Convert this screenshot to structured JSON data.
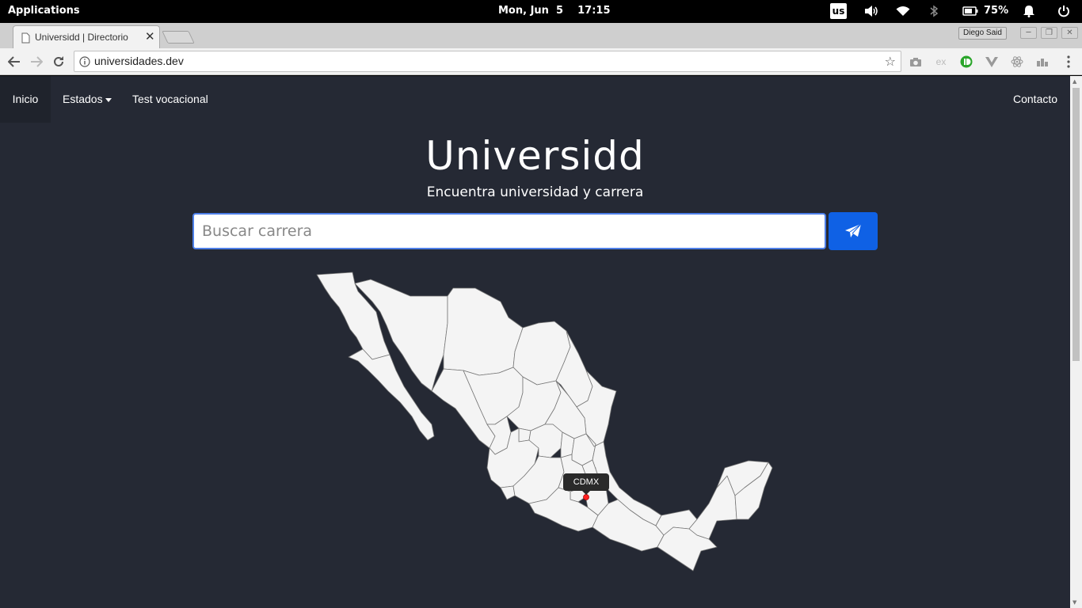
{
  "topbar": {
    "applications": "Applications",
    "date": "Mon, Jun  5",
    "time": "17:15",
    "keyboard_layout": "us",
    "battery_percent": "75%"
  },
  "browser": {
    "tab_title": "Universidd | Directorio",
    "profile_name": "Diego Said",
    "url": "universidades.dev"
  },
  "nav": {
    "items": [
      {
        "label": "Inicio",
        "active": true
      },
      {
        "label": "Estados",
        "dropdown": true
      },
      {
        "label": "Test vocacional"
      }
    ],
    "right_item": "Contacto"
  },
  "hero": {
    "title": "Universidd",
    "subtitle": "Encuentra universidad y carrera"
  },
  "search": {
    "placeholder": "Buscar carrera",
    "button_icon": "paper-plane-icon"
  },
  "map": {
    "marker_label": "CDMX",
    "marker_color": "#ff2020"
  },
  "colors": {
    "page_bg": "#252934",
    "accent": "#0f61e5",
    "map_fill": "#f4f4f4"
  }
}
